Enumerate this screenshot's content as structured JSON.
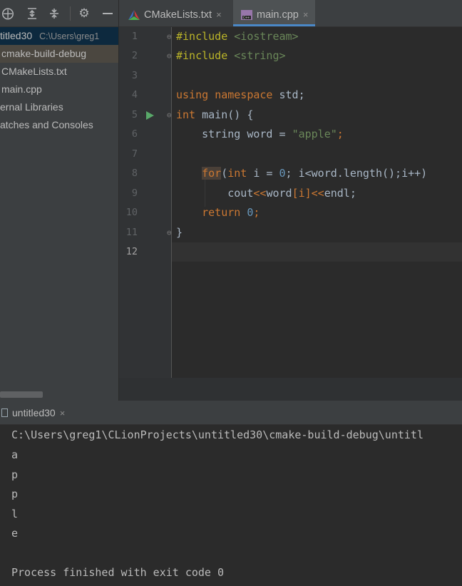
{
  "project": {
    "toolbar_icons": [
      "crosshair-icon",
      "expand-all-icon",
      "collapse-all-icon",
      "gear-icon",
      "minimize-icon"
    ],
    "root_name": "titled30",
    "root_path": "C:\\Users\\greg1",
    "items": [
      {
        "label": "cmake-build-debug"
      },
      {
        "label": "CMakeLists.txt"
      },
      {
        "label": "main.cpp"
      },
      {
        "label": "ernal Libraries"
      },
      {
        "label": "atches and Consoles"
      }
    ]
  },
  "editor": {
    "tabs": [
      {
        "label": "CMakeLists.txt",
        "close": "×",
        "active": false
      },
      {
        "label": "main.cpp",
        "close": "×",
        "active": true
      }
    ],
    "current_line": 12,
    "line_numbers": [
      "1",
      "2",
      "3",
      "4",
      "5",
      "6",
      "7",
      "8",
      "9",
      "10",
      "11",
      "12"
    ],
    "code": {
      "l1_directive": "#include",
      "l1_header": "<iostream>",
      "l2_directive": "#include",
      "l2_header": "<string>",
      "l4_using": "using",
      "l4_namespace": "namespace",
      "l4_rest": "std;",
      "l5_type": "int",
      "l5_rest": "main() {",
      "l6_decl": "string word = ",
      "l6_string": "\"apple\"",
      "l6_end": ";",
      "l8_for": "for",
      "l8_paren": "(",
      "l8_int": "int",
      "l8_mid": " i = ",
      "l8_zero": "0",
      "l8_rest": "; i<word.length();i++)",
      "l9_cout": "cout",
      "l9_op1": "<<",
      "l9_word": "word",
      "l9_idx": "[i]",
      "l9_op2": "<<",
      "l9_endl": "endl;",
      "l10_return": "return",
      "l10_zero": "0",
      "l10_end": ";",
      "l11_brace": "}"
    },
    "colors": {
      "keyword": "#cc7832",
      "string": "#6a8759",
      "number": "#6897bb",
      "text": "#a9b7c6",
      "run_arrow": "#59a869",
      "active_tab_underline": "#4a88c7"
    }
  },
  "run": {
    "tab_label": "untitled30",
    "tab_close": "×",
    "path_line": "C:\\Users\\greg1\\CLionProjects\\untitled30\\cmake-build-debug\\untitl",
    "output_lines": [
      "a",
      "p",
      "p",
      "l",
      "e"
    ],
    "exit_message": "Process finished with exit code 0"
  }
}
